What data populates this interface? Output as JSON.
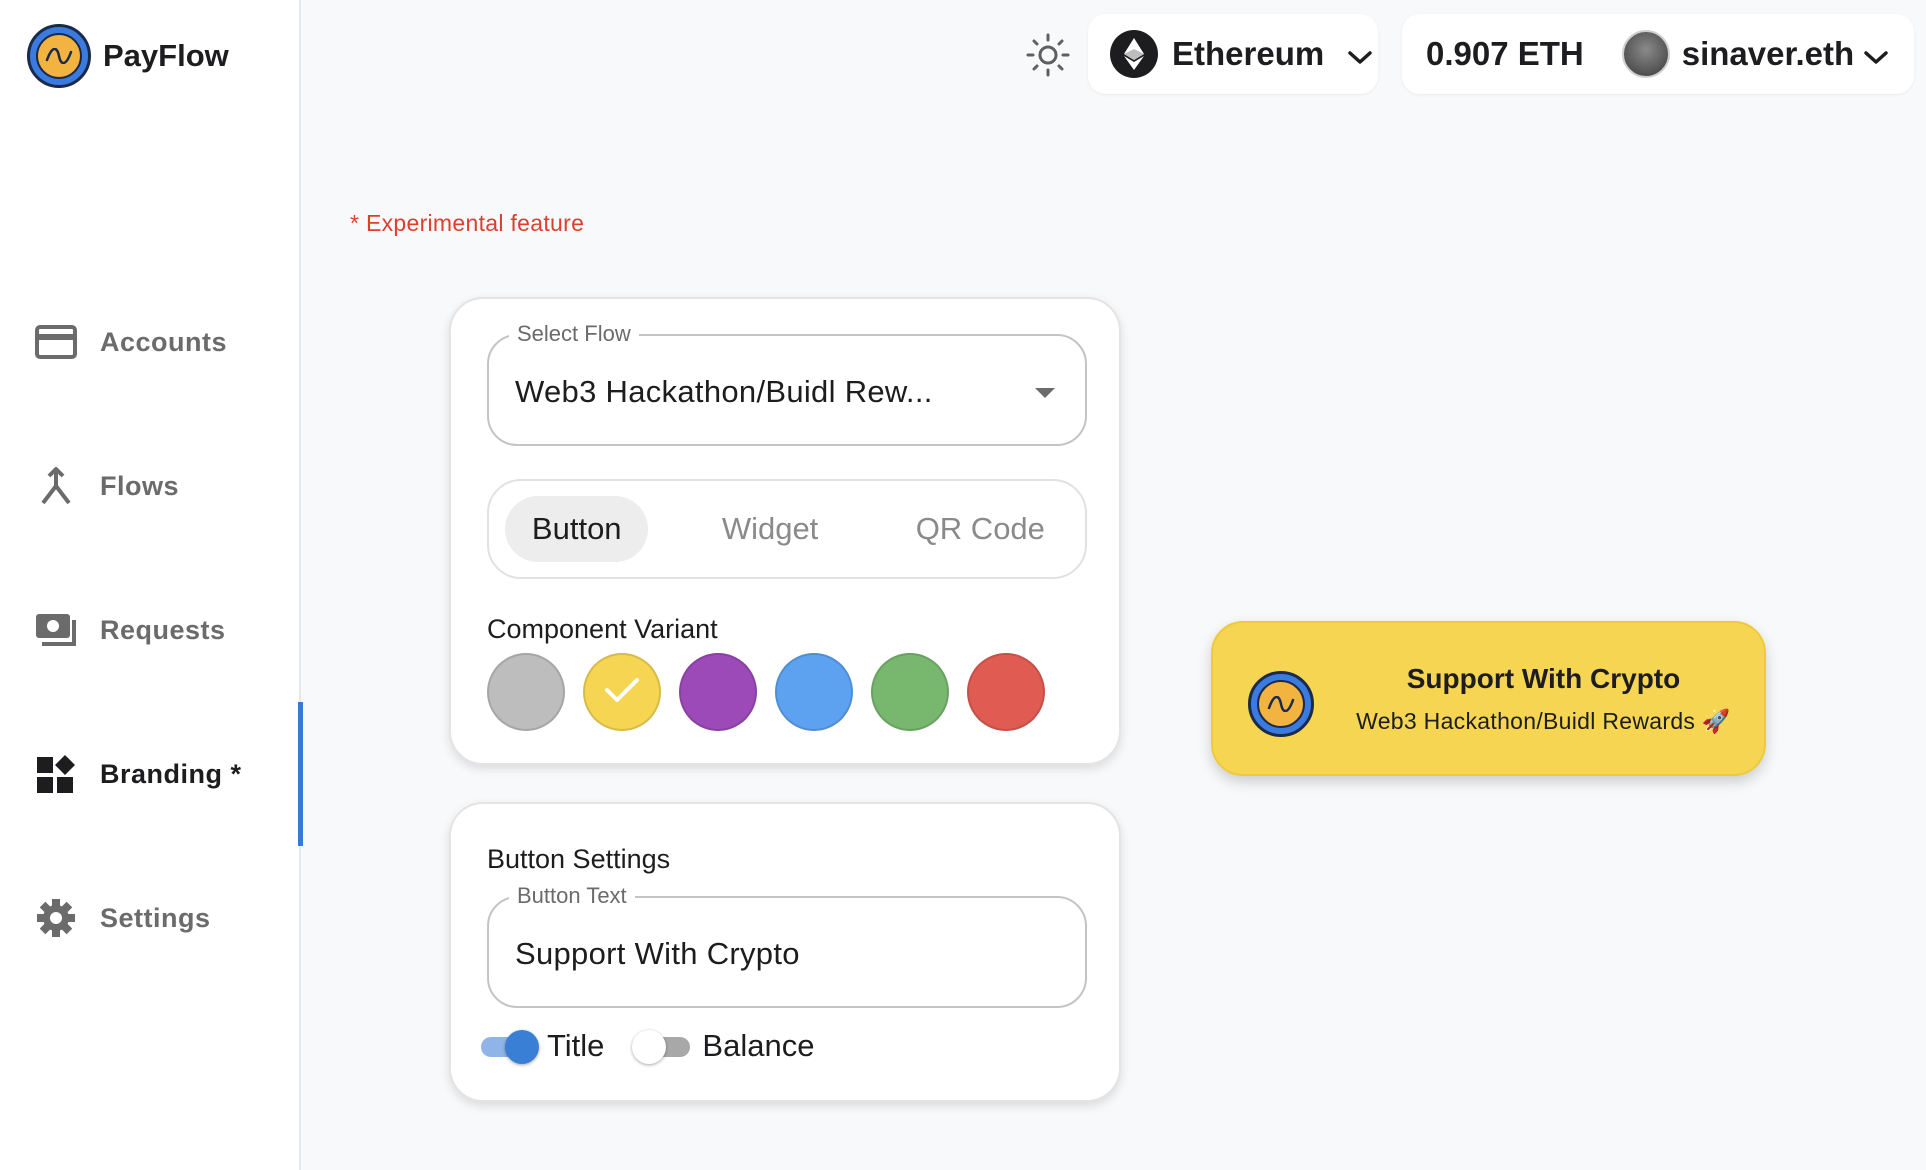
{
  "app": {
    "name": "PayFlow"
  },
  "sidebar": {
    "items": [
      {
        "label": "Accounts",
        "icon": "credit-card-icon"
      },
      {
        "label": "Flows",
        "icon": "merge-icon"
      },
      {
        "label": "Requests",
        "icon": "payments-icon"
      },
      {
        "label": "Branding *",
        "icon": "widgets-icon",
        "active": true
      },
      {
        "label": "Settings",
        "icon": "gear-icon"
      }
    ]
  },
  "topbar": {
    "theme_icon": "sun-icon",
    "network": "Ethereum",
    "balance": "0.907 ETH",
    "account": "sinaver.eth"
  },
  "note": "* Experimental feature",
  "flow_card": {
    "select_label": "Select Flow",
    "select_value": "Web3 Hackathon/Buidl Rew...",
    "tabs": [
      "Button",
      "Widget",
      "QR Code"
    ],
    "active_tab": "Button",
    "variant_label": "Component Variant",
    "variants": [
      {
        "name": "gray",
        "color": "#bdbdbd"
      },
      {
        "name": "yellow",
        "color": "#f5d552",
        "selected": true
      },
      {
        "name": "purple",
        "color": "#9c4ab8"
      },
      {
        "name": "blue",
        "color": "#5ca2f0"
      },
      {
        "name": "green",
        "color": "#78b86e"
      },
      {
        "name": "red",
        "color": "#e05c52"
      }
    ]
  },
  "settings_card": {
    "title": "Button Settings",
    "text_label": "Button Text",
    "text_value": "Support With Crypto",
    "toggles": [
      {
        "label": "Title",
        "on": true
      },
      {
        "label": "Balance",
        "on": false
      }
    ]
  },
  "preview": {
    "title": "Support With Crypto",
    "subtitle": "Web3 Hackathon/Buidl Rewards 🚀",
    "bg_color": "#f5d552"
  }
}
